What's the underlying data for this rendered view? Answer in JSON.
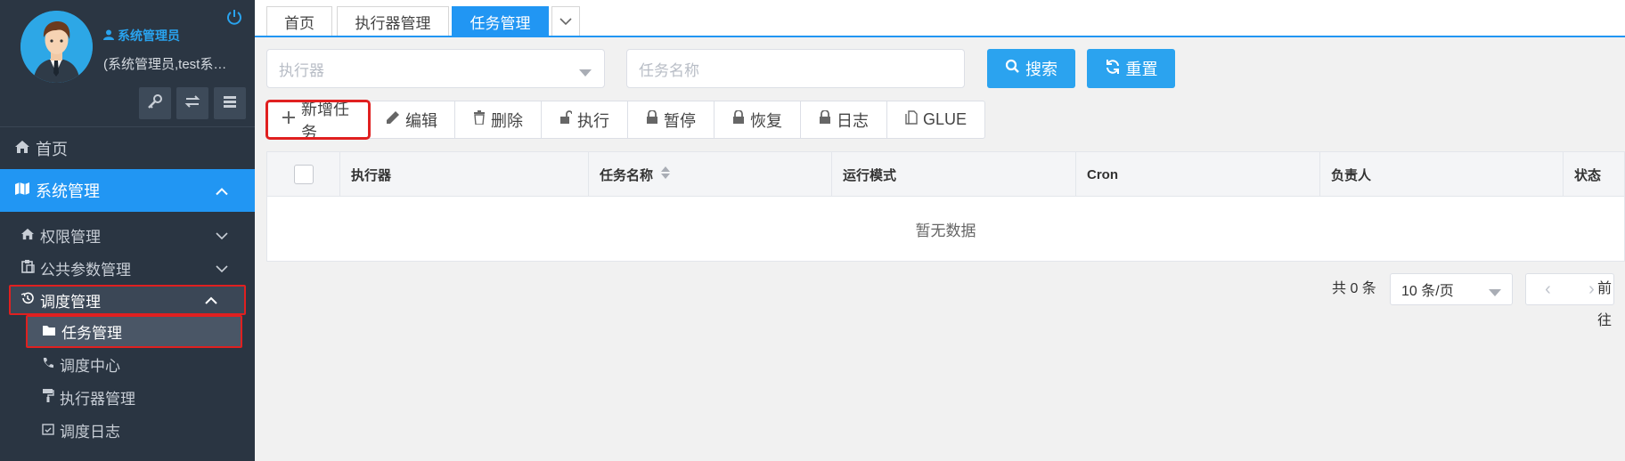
{
  "user": {
    "name": "系统管理员",
    "sub": "(系统管理员,test系统管理员)"
  },
  "nav": {
    "home": "首页",
    "system": "系统管理",
    "sub": {
      "perm": "权限管理",
      "params": "公共参数管理",
      "schedule": "调度管理"
    },
    "schedule_items": {
      "task": "任务管理",
      "center": "调度中心",
      "executor": "执行器管理",
      "log": "调度日志"
    }
  },
  "tabs": {
    "home": "首页",
    "executor": "执行器管理",
    "task": "任务管理"
  },
  "search": {
    "executor_placeholder": "执行器",
    "task_placeholder": "任务名称",
    "search_label": "搜索",
    "reset_label": "重置"
  },
  "toolbar": {
    "add": "新增任务",
    "edit": "编辑",
    "delete": "删除",
    "run": "执行",
    "pause": "暂停",
    "resume": "恢复",
    "log": "日志",
    "glue": "GLUE"
  },
  "table": {
    "columns": [
      "执行器",
      "任务名称",
      "运行模式",
      "Cron",
      "负责人",
      "状态"
    ],
    "empty": "暂无数据"
  },
  "pager": {
    "total": "共 0 条",
    "size": "10 条/页",
    "goto": "前往"
  },
  "colors": {
    "primary": "#2196f3",
    "sidebar": "#2a3542",
    "highlight": "#e02020"
  }
}
